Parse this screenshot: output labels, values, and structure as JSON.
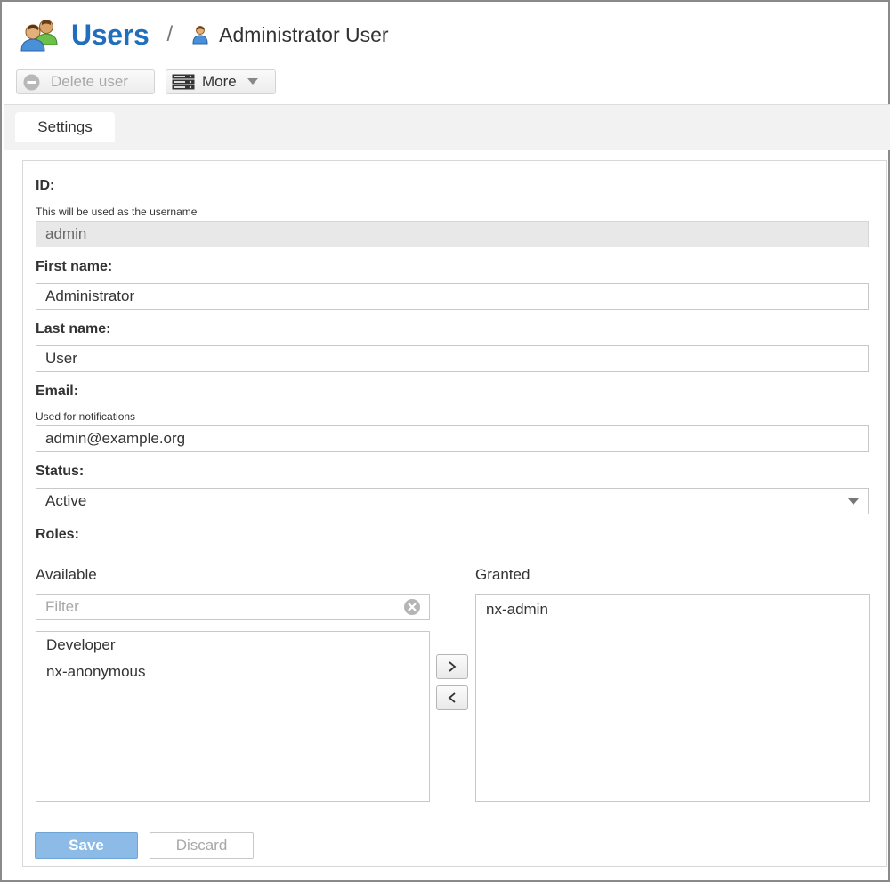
{
  "header": {
    "breadcrumb_root": "Users",
    "separator": "/",
    "breadcrumb_current": "Administrator User",
    "root_icon": "users-icon",
    "current_icon": "user-icon"
  },
  "toolbar": {
    "delete_label": "Delete user",
    "delete_icon": "minus-circle-icon",
    "more_label": "More",
    "more_icon": "server-icon"
  },
  "tabs": [
    {
      "label": "Settings",
      "active": true
    }
  ],
  "form": {
    "id": {
      "label": "ID:",
      "help": "This will be used as the username",
      "value": "admin",
      "readonly": true
    },
    "first_name": {
      "label": "First name:",
      "value": "Administrator"
    },
    "last_name": {
      "label": "Last name:",
      "value": "User"
    },
    "email": {
      "label": "Email:",
      "help": "Used for notifications",
      "value": "admin@example.org"
    },
    "status": {
      "label": "Status:",
      "value": "Active"
    },
    "roles": {
      "label": "Roles:",
      "available_label": "Available",
      "granted_label": "Granted",
      "filter_placeholder": "Filter",
      "available": [
        "Developer",
        "nx-anonymous"
      ],
      "granted": [
        "nx-admin"
      ],
      "add_label": ">",
      "remove_label": "<"
    }
  },
  "actions": {
    "save_label": "Save",
    "discard_label": "Discard"
  },
  "colors": {
    "brand_blue": "#1f6fbd",
    "save_button": "#8bbbe6",
    "readonly_field": "#e8e8e8"
  }
}
